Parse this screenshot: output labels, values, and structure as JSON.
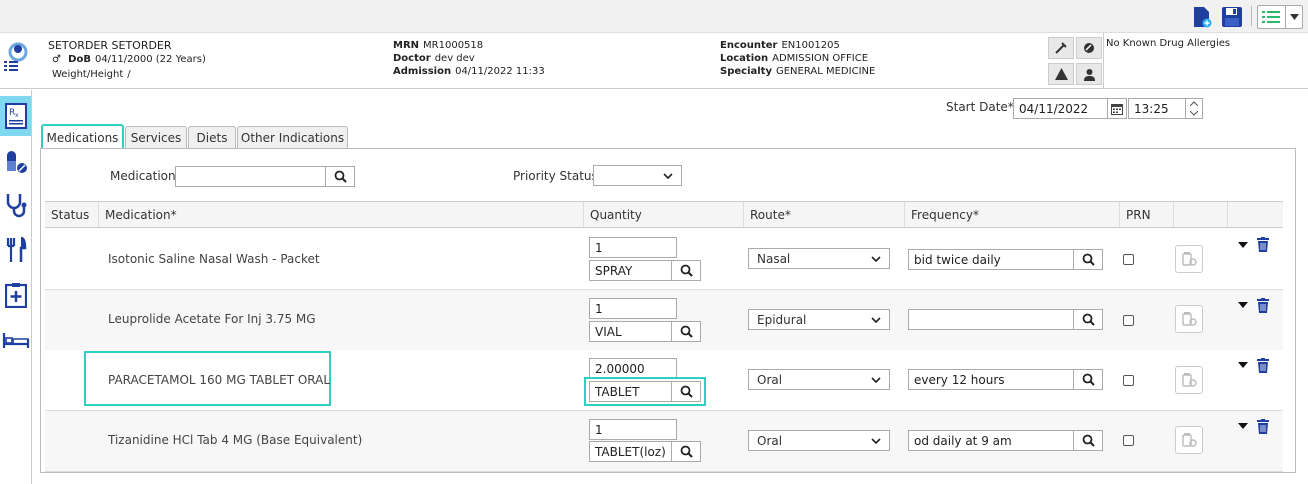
{
  "patient": {
    "name": "SETORDER SETORDER",
    "dob_label": "DoB",
    "dob": "04/11/2000 (22 Years)",
    "weight_height_label": "Weight/Height",
    "weight_height": "/",
    "mrn_label": "MRN",
    "mrn": "MR1000518",
    "doctor_label": "Doctor",
    "doctor": "dev dev",
    "admission_label": "Admission",
    "admission": "04/11/2022 11:33",
    "encounter_label": "Encounter",
    "encounter": "EN1001205",
    "location_label": "Location",
    "location": "ADMISSION OFFICE",
    "specialty_label": "Specialty",
    "specialty": "GENERAL MEDICINE",
    "allergies": "No Known Drug Allergies"
  },
  "start": {
    "label": "Start Date*",
    "date": "04/11/2022",
    "time": "13:25"
  },
  "tabs": [
    {
      "label": "Medications"
    },
    {
      "label": "Services"
    },
    {
      "label": "Diets"
    },
    {
      "label": "Other Indications"
    }
  ],
  "filters": {
    "medication_label": "Medication",
    "priority_label": "Priority Status"
  },
  "columns": [
    "Status",
    "Medication*",
    "Quantity",
    "Route*",
    "Frequency*",
    "PRN"
  ],
  "rows": [
    {
      "medication": "Isotonic Saline Nasal Wash - Packet",
      "qty": "1",
      "unit": "SPRAY",
      "route": "Nasal",
      "frequency": "bid twice daily"
    },
    {
      "medication": "Leuprolide Acetate For Inj 3.75 MG",
      "qty": "1",
      "unit": "VIAL",
      "route": "Epidural",
      "frequency": ""
    },
    {
      "medication": "PARACETAMOL 160 MG TABLET ORAL",
      "qty": "2.00000",
      "unit": "TABLET",
      "route": "Oral",
      "frequency": "every 12 hours"
    },
    {
      "medication": "Tizanidine HCl Tab 4 MG (Base Equivalent)",
      "qty": "1",
      "unit": "TABLET(loz)",
      "route": "Oral",
      "frequency": "od daily at 9 am"
    }
  ],
  "colors": {
    "accent": "#2fd0c4",
    "navy": "#1f3fa0",
    "rail_active": "#7fd8ef"
  }
}
